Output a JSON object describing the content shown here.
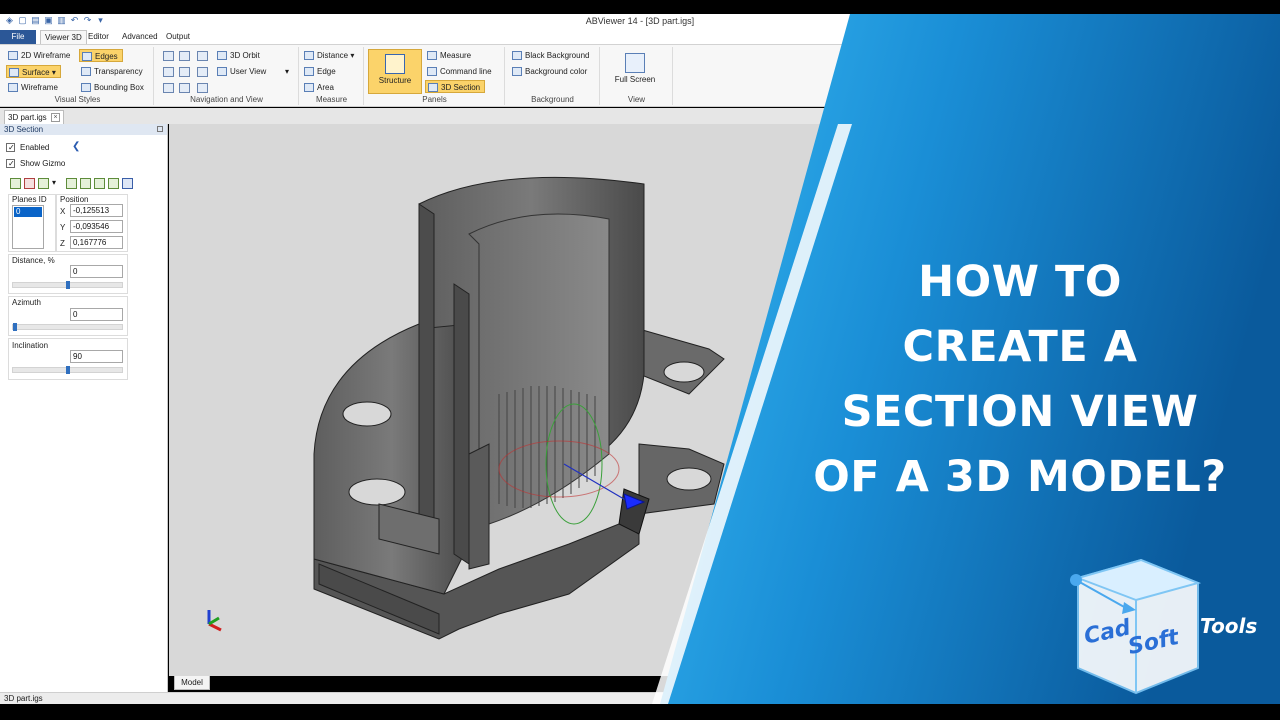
{
  "app": {
    "title": "ABViewer 14 - [3D part.igs]"
  },
  "menu_tabs": [
    {
      "label": "File"
    },
    {
      "label": "Viewer 3D"
    },
    {
      "label": "Editor"
    },
    {
      "label": "Advanced"
    },
    {
      "label": "Output"
    }
  ],
  "ribbon": {
    "visual_styles": {
      "label": "Visual Styles",
      "wireframe_2d": "2D Wireframe",
      "surface": "Surface",
      "wireframe": "Wireframe",
      "edges": "Edges",
      "transparency": "Transparency",
      "bounding_box": "Bounding Box"
    },
    "navigation": {
      "label": "Navigation and View",
      "orbit_3d": "3D Orbit",
      "user_view": "User View"
    },
    "measure": {
      "label": "Measure",
      "distance": "Distance",
      "edge": "Edge",
      "area": "Area"
    },
    "panels": {
      "label": "Panels",
      "structure": "Structure",
      "measure": "Measure",
      "command_line": "Command line",
      "section_3d": "3D Section"
    },
    "background": {
      "label": "Background",
      "black_background": "Black Background",
      "background_color": "Background color"
    },
    "view": {
      "label": "View",
      "full_screen": "Full Screen"
    }
  },
  "document_tab": "3D part.igs",
  "section_panel": {
    "title": "3D Section",
    "enabled_label": "Enabled",
    "show_gizmo_label": "Show Gizmo",
    "planes_id_label": "Planes ID",
    "planes": [
      "0"
    ],
    "position_label": "Position",
    "x_label": "X",
    "x_value": "-0,125513",
    "y_label": "Y",
    "y_value": "-0,093546",
    "z_label": "Z",
    "z_value": "0,167776",
    "distance_label": "Distance, %",
    "distance_value": "0",
    "azimuth_label": "Azimuth",
    "azimuth_value": "0",
    "inclination_label": "Inclination",
    "inclination_value": "90"
  },
  "viewport": {
    "model_tab": "Model"
  },
  "status_bar": {
    "file": "3D part.igs"
  },
  "promo": {
    "headline_lines": [
      "HOW TO",
      "CREATE A",
      "SECTION VIEW",
      "OF A 3D MODEL?"
    ],
    "logo_word_1": "Cad",
    "logo_word_2": "Soft",
    "logo_word_3": "Tools"
  },
  "colors": {
    "accent_blue": "#1e9de6",
    "ribbon_highlight": "#fbd36a",
    "file_tab": "#2b5797"
  }
}
